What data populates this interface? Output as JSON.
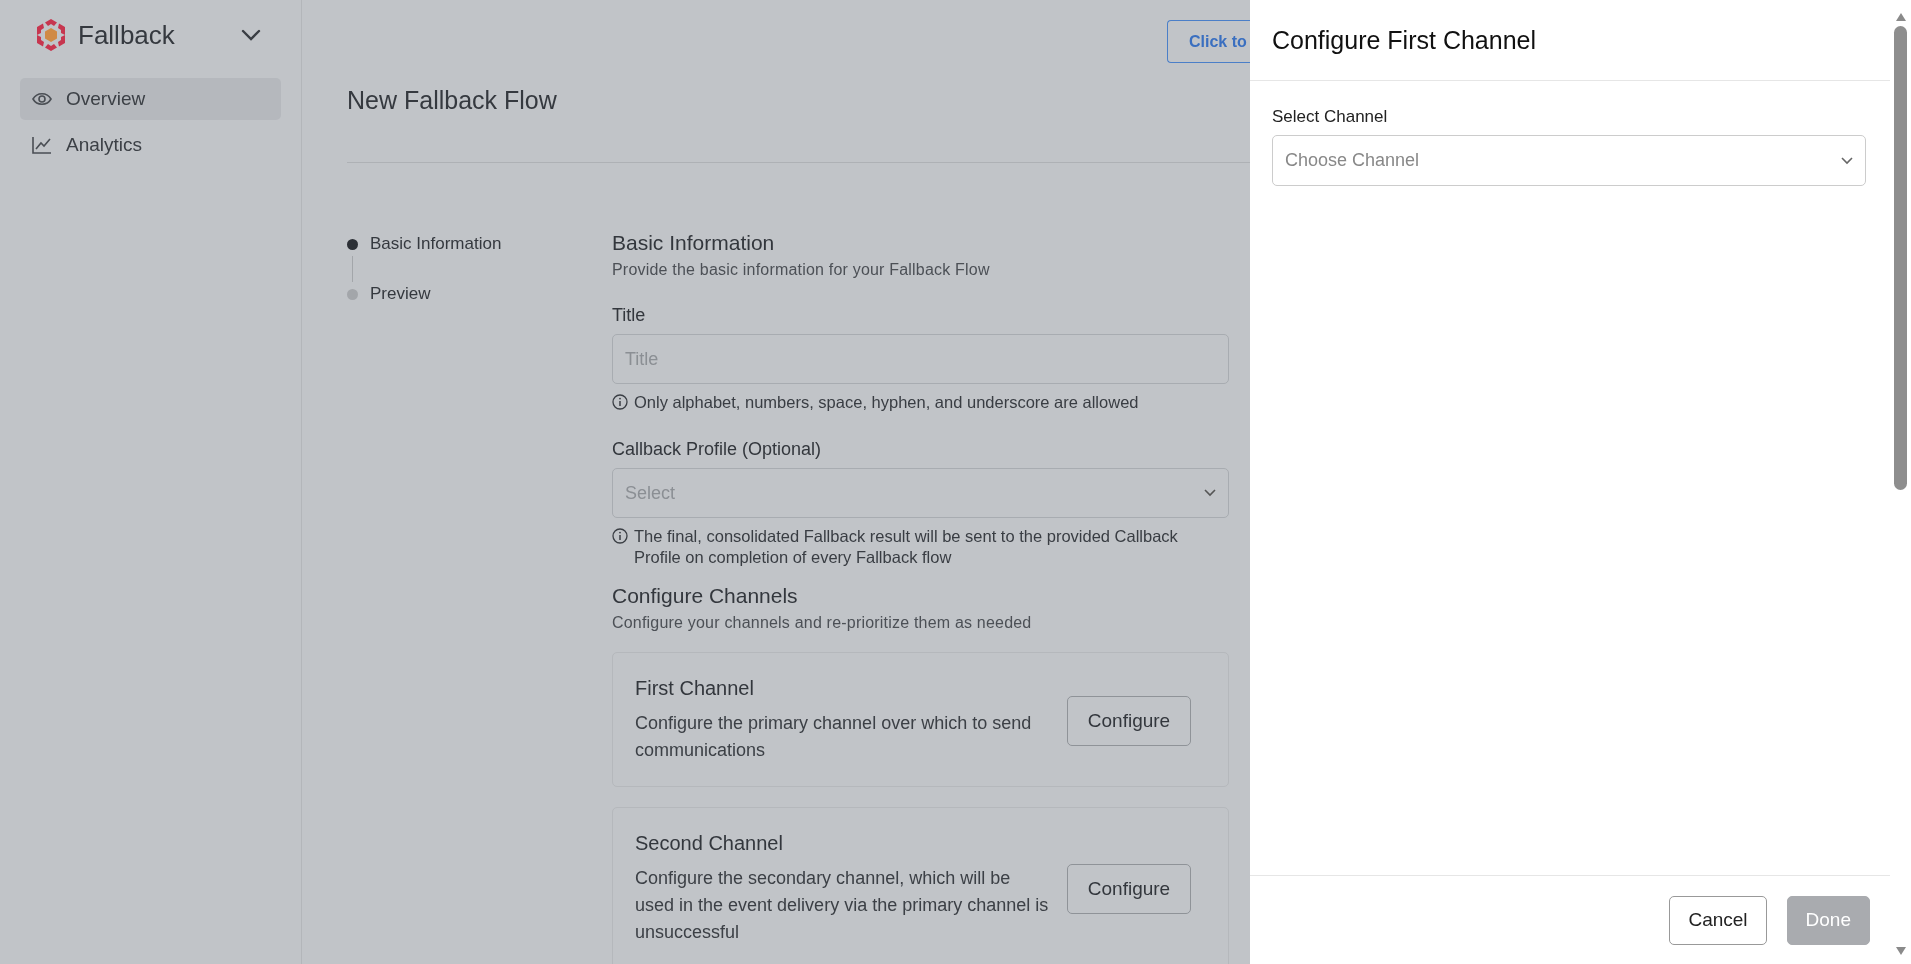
{
  "sidebar": {
    "brand": "Fallback",
    "items": [
      {
        "label": "Overview",
        "kind": "eye",
        "selected": true
      },
      {
        "label": "Analytics",
        "kind": "chart",
        "selected": false
      }
    ]
  },
  "header": {
    "title": "New Fallback Flow",
    "action_button": "Click to"
  },
  "stepper": [
    {
      "label": "Basic Information",
      "active": true
    },
    {
      "label": "Preview",
      "active": false
    }
  ],
  "basic_information": {
    "title": "Basic Information",
    "subtitle": "Provide the basic information for your Fallback Flow",
    "fields": [
      {
        "kind": "input",
        "label": "Title",
        "placeholder": "Title",
        "hint": "Only alphabet, numbers, space, hyphen, and underscore are allowed"
      },
      {
        "kind": "select",
        "label": "Callback Profile (Optional)",
        "placeholder": "Select",
        "hint": "The final, consolidated Fallback result will be sent to the provided Callback Profile on completion of every Fallback flow"
      }
    ]
  },
  "configure_channels": {
    "title": "Configure Channels",
    "subtitle": "Configure your channels and re-prioritize them as needed",
    "cards": [
      {
        "title": "First Channel",
        "description": "Configure the primary channel over which to send communications",
        "button": "Configure"
      },
      {
        "title": "Second Channel",
        "description": "Configure the secondary channel, which will be used in the event delivery via the primary channel is unsuccessful",
        "button": "Configure"
      }
    ]
  },
  "drawer": {
    "title": "Configure First Channel",
    "field": {
      "label": "Select Channel",
      "placeholder": "Choose Channel"
    },
    "buttons": [
      {
        "label": "Cancel",
        "disabled": false
      },
      {
        "label": "Done",
        "disabled": true
      }
    ]
  }
}
